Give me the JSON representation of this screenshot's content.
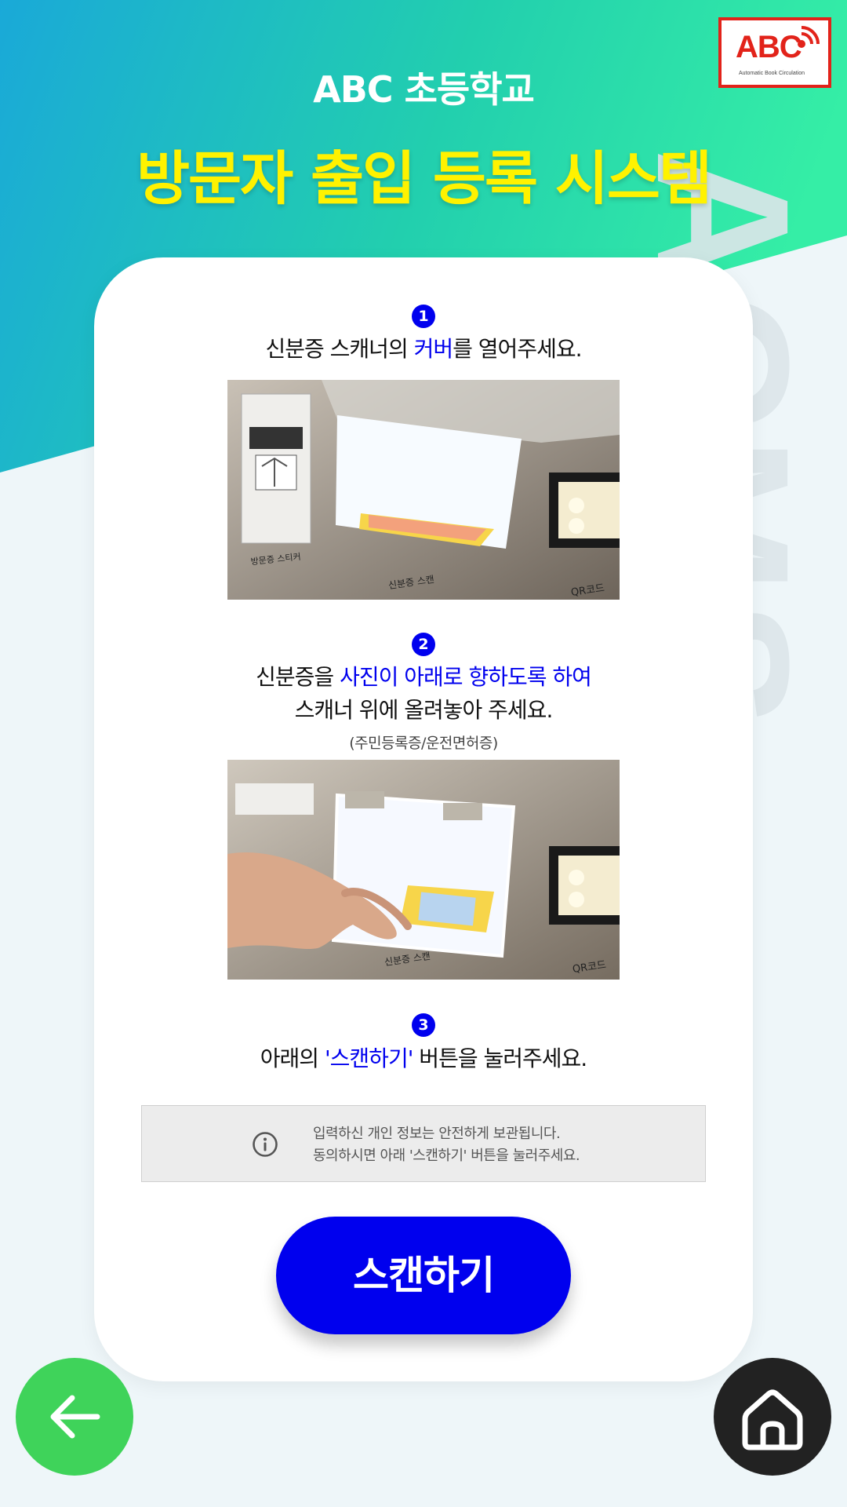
{
  "header": {
    "logo_text": "ABC",
    "logo_subtext": "Automatic Book Circulation",
    "school_name": "ABC 초등학교",
    "system_title": "방문자 출입 등록 시스템",
    "watermark": "ACMS"
  },
  "steps": [
    {
      "number": "1",
      "text_before": "신분증 스캐너의 ",
      "highlight": "커버",
      "text_after": "를 열어주세요.",
      "photo_labels": [
        "방문증 스티커",
        "신분증 스캔",
        "QR코드"
      ]
    },
    {
      "number": "2",
      "text_before": "신분증을 ",
      "highlight": "사진이 아래로 향하도록 하여",
      "line2": "스캐너 위에 올려놓아 주세요.",
      "note": "(주민등록증/운전면허증)",
      "photo_labels": [
        "신분증 스캔",
        "QR코드"
      ]
    },
    {
      "number": "3",
      "text_before": "아래의 ",
      "highlight": "'스캔하기'",
      "text_after": " 버튼을 눌러주세요."
    }
  ],
  "notice": {
    "line1": "입력하신 개인 정보는 안전하게 보관됩니다.",
    "line2": "동의하시면 아래 '스캔하기' 버튼을 눌러주세요.",
    "icon": "info-icon"
  },
  "actions": {
    "scan_label": "스캔하기",
    "back_icon": "arrow-left-icon",
    "home_icon": "home-icon"
  },
  "colors": {
    "accent_blue": "#0000ee",
    "title_yellow": "#fff200",
    "back_green": "#3fd35a",
    "home_dark": "#222222",
    "logo_red": "#e2231a"
  }
}
